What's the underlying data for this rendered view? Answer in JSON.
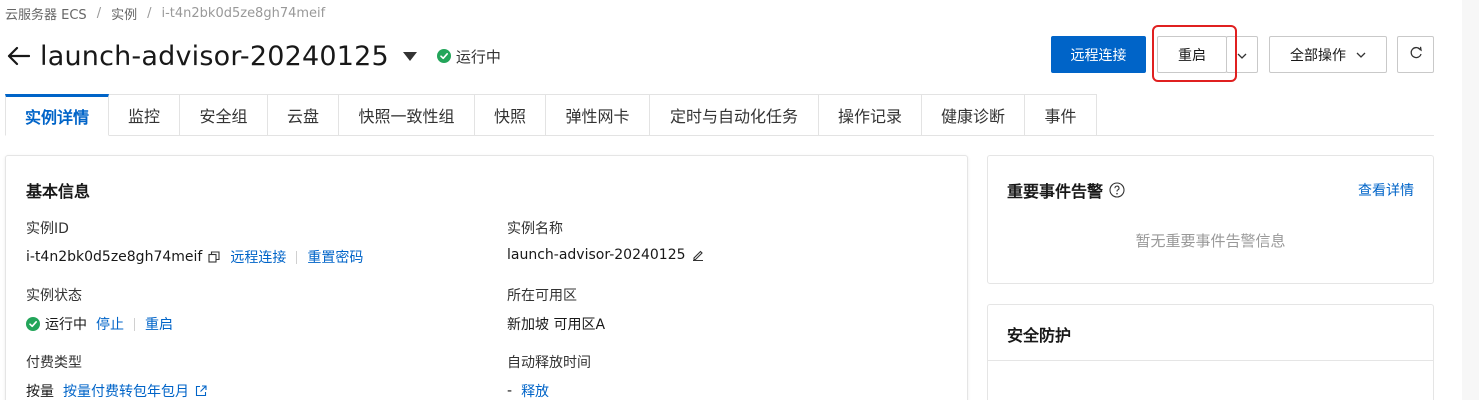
{
  "breadcrumb": {
    "items": [
      "云服务器 ECS",
      "实例",
      "i-t4n2bk0d5ze8gh74meif"
    ],
    "separator": "/"
  },
  "header": {
    "title": "launch-advisor-20240125",
    "status": "运行中",
    "status_color": "#23a55a"
  },
  "actions": {
    "remote_connect": "远程连接",
    "restart": "重启",
    "all_operations": "全部操作"
  },
  "tabs": [
    "实例详情",
    "监控",
    "安全组",
    "云盘",
    "快照一致性组",
    "快照",
    "弹性网卡",
    "定时与自动化任务",
    "操作记录",
    "健康诊断",
    "事件"
  ],
  "active_tab": "实例详情",
  "basic_info": {
    "title": "基本信息",
    "instance_id": {
      "label": "实例ID",
      "value": "i-t4n2bk0d5ze8gh74meif",
      "link_remote": "远程连接",
      "link_reset_password": "重置密码"
    },
    "instance_name": {
      "label": "实例名称",
      "value": "launch-advisor-20240125"
    },
    "instance_status": {
      "label": "实例状态",
      "value": "运行中",
      "link_stop": "停止",
      "link_restart": "重启"
    },
    "zone": {
      "label": "所在可用区",
      "value": "新加坡 可用区A"
    },
    "billing": {
      "label": "付费类型",
      "value": "按量",
      "link_convert": "按量付费转包年包月"
    },
    "auto_release": {
      "label": "自动释放时间",
      "value": "-",
      "link_release": "释放"
    }
  },
  "events_card": {
    "title": "重要事件告警",
    "view_details": "查看详情",
    "empty_text": "暂无重要事件告警信息"
  },
  "security_card": {
    "title": "安全防护"
  },
  "colors": {
    "primary": "#0064c8",
    "highlight": "#e02020",
    "running": "#23a55a"
  }
}
